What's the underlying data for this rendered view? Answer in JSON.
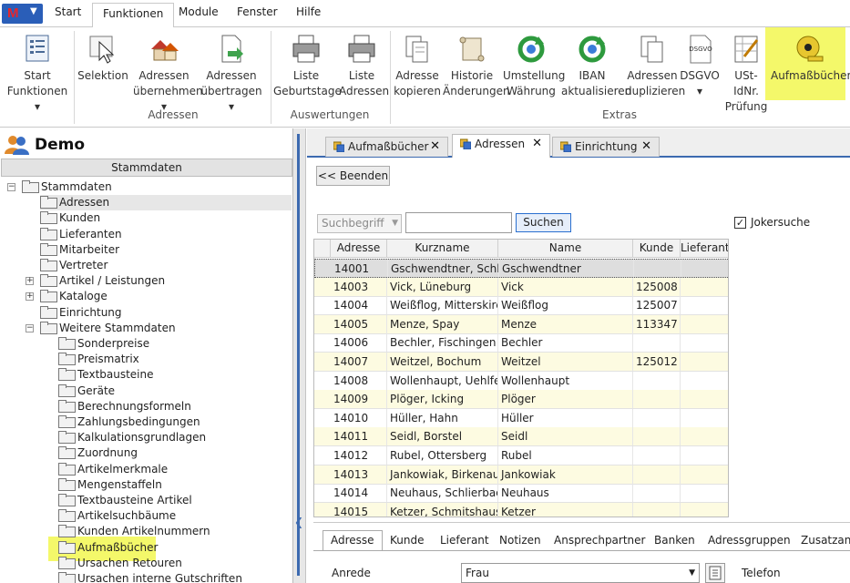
{
  "menu": {
    "tabs": [
      "Start",
      "Funktionen",
      "Module",
      "Fenster",
      "Hilfe"
    ],
    "active_tab": "Funktionen"
  },
  "ribbon": {
    "groups": [
      {
        "label": "Adressen"
      },
      {
        "label": "Auswertungen"
      },
      {
        "label": "Extras"
      }
    ],
    "buttons": [
      {
        "line1": "Start",
        "line2": "Funktionen ▾",
        "icon": "list-icon"
      },
      {
        "line1": "Selektion",
        "line2": "",
        "icon": "selection-icon"
      },
      {
        "line1": "Adressen",
        "line2": "übernehmen ▾",
        "icon": "houses-icon"
      },
      {
        "line1": "Adressen",
        "line2": "übertragen ▾",
        "icon": "document-export-icon"
      },
      {
        "line1": "Liste",
        "line2": "Geburtstage",
        "icon": "printer-icon"
      },
      {
        "line1": "Liste",
        "line2": "Adressen",
        "icon": "printer-icon"
      },
      {
        "line1": "Adresse",
        "line2": "kopieren",
        "icon": "copy-icon"
      },
      {
        "line1": "Historie",
        "line2": "Änderungen",
        "icon": "scroll-icon"
      },
      {
        "line1": "Umstellung",
        "line2": "Währung",
        "icon": "refresh-icon"
      },
      {
        "line1": "IBAN",
        "line2": "aktualisieren",
        "icon": "refresh-icon"
      },
      {
        "line1": "Adressen",
        "line2": "duplizieren",
        "icon": "duplicate-icon"
      },
      {
        "line1": "DSGVO",
        "line2": "▾",
        "icon": "dsgvo-icon",
        "badge": "DSGVO"
      },
      {
        "line1": "USt-IdNr.",
        "line2": "Prüfung",
        "icon": "checklist-icon"
      },
      {
        "line1": "Aufmaßbücher",
        "line2": "",
        "icon": "tape-measure-icon"
      }
    ]
  },
  "left": {
    "title": "Demo",
    "section_header": "Stammdaten",
    "tree": [
      {
        "label": "Stammdaten",
        "level": 0,
        "expander": "−"
      },
      {
        "label": "Adressen",
        "level": 1,
        "selected": true
      },
      {
        "label": "Kunden",
        "level": 1
      },
      {
        "label": "Lieferanten",
        "level": 1
      },
      {
        "label": "Mitarbeiter",
        "level": 1
      },
      {
        "label": "Vertreter",
        "level": 1
      },
      {
        "label": "Artikel / Leistungen",
        "level": 1,
        "expander": "+"
      },
      {
        "label": "Kataloge",
        "level": 1,
        "expander": "+"
      },
      {
        "label": "Einrichtung",
        "level": 1
      },
      {
        "label": "Weitere Stammdaten",
        "level": 1,
        "expander": "−"
      },
      {
        "label": "Sonderpreise",
        "level": 2
      },
      {
        "label": "Preismatrix",
        "level": 2
      },
      {
        "label": "Textbausteine",
        "level": 2
      },
      {
        "label": "Geräte",
        "level": 2
      },
      {
        "label": "Berechnungsformeln",
        "level": 2
      },
      {
        "label": "Zahlungsbedingungen",
        "level": 2
      },
      {
        "label": "Kalkulationsgrundlagen",
        "level": 2
      },
      {
        "label": "Zuordnung",
        "level": 2
      },
      {
        "label": "Artikelmerkmale",
        "level": 2
      },
      {
        "label": "Mengenstaffeln",
        "level": 2
      },
      {
        "label": "Textbausteine Artikel",
        "level": 2
      },
      {
        "label": "Artikelsuchbäume",
        "level": 2
      },
      {
        "label": "Kunden Artikelnummern",
        "level": 2
      },
      {
        "label": "Aufmaßbücher",
        "level": 2,
        "highlight": true
      },
      {
        "label": "Ursachen Retouren",
        "level": 2
      },
      {
        "label": "Ursachen interne Gutschriften",
        "level": 2
      }
    ]
  },
  "doc_tabs": [
    {
      "label": "Aufmaßbücher",
      "close": "✕"
    },
    {
      "label": "Adressen",
      "close": "✕",
      "active": true
    },
    {
      "label": "Einrichtung",
      "close": "✕"
    }
  ],
  "toolbar": {
    "beenden": "<< Beenden",
    "search_field_placeholder": "Suchbegriff",
    "search_value": "",
    "suchen": "Suchen",
    "joker_label": "Jokersuche",
    "joker_checked": "✓"
  },
  "grid": {
    "columns": [
      "Adresse",
      "Kurzname",
      "Name",
      "Kunde",
      "Lieferant"
    ],
    "rows": [
      [
        "14001",
        "Gschwendtner, Schliersee",
        "Gschwendtner",
        "",
        ""
      ],
      [
        "14003",
        "Vick, Lüneburg",
        "Vick",
        "125008",
        ""
      ],
      [
        "14004",
        "Weißflog, Mitterskirchen",
        "Weißflog",
        "125007",
        ""
      ],
      [
        "14005",
        "Menze, Spay",
        "Menze",
        "113347",
        ""
      ],
      [
        "14006",
        "Bechler, Fischingen",
        "Bechler",
        "",
        ""
      ],
      [
        "14007",
        "Weitzel, Bochum",
        "Weitzel",
        "125012",
        ""
      ],
      [
        "14008",
        "Wollenhaupt, Uehlfeld",
        "Wollenhaupt",
        "",
        ""
      ],
      [
        "14009",
        "Plöger, Icking",
        "Plöger",
        "",
        ""
      ],
      [
        "14010",
        "Hüller, Hahn",
        "Hüller",
        "",
        ""
      ],
      [
        "14011",
        "Seidl, Borstel",
        "Seidl",
        "",
        ""
      ],
      [
        "14012",
        "Rubel, Ottersberg",
        "Rubel",
        "",
        ""
      ],
      [
        "14013",
        "Jankowiak, Birkenau",
        "Jankowiak",
        "",
        ""
      ],
      [
        "14014",
        "Neuhaus, Schlierbach",
        "Neuhaus",
        "",
        ""
      ],
      [
        "14015",
        "Ketzer, Schmitshausen",
        "Ketzer",
        "",
        ""
      ]
    ]
  },
  "detail": {
    "tabs": [
      "Adresse",
      "Kunde",
      "Lieferant",
      "Notizen",
      "Ansprechpartner",
      "Banken",
      "Adressgruppen",
      "Zusatzans"
    ],
    "anrede_label": "Anrede",
    "anrede_value": "Frau",
    "telefon_label": "Telefon"
  },
  "colors": {
    "highlight": "#f4f86a",
    "accent": "#3c6ab0",
    "row_alt": "#fdfbe1"
  }
}
